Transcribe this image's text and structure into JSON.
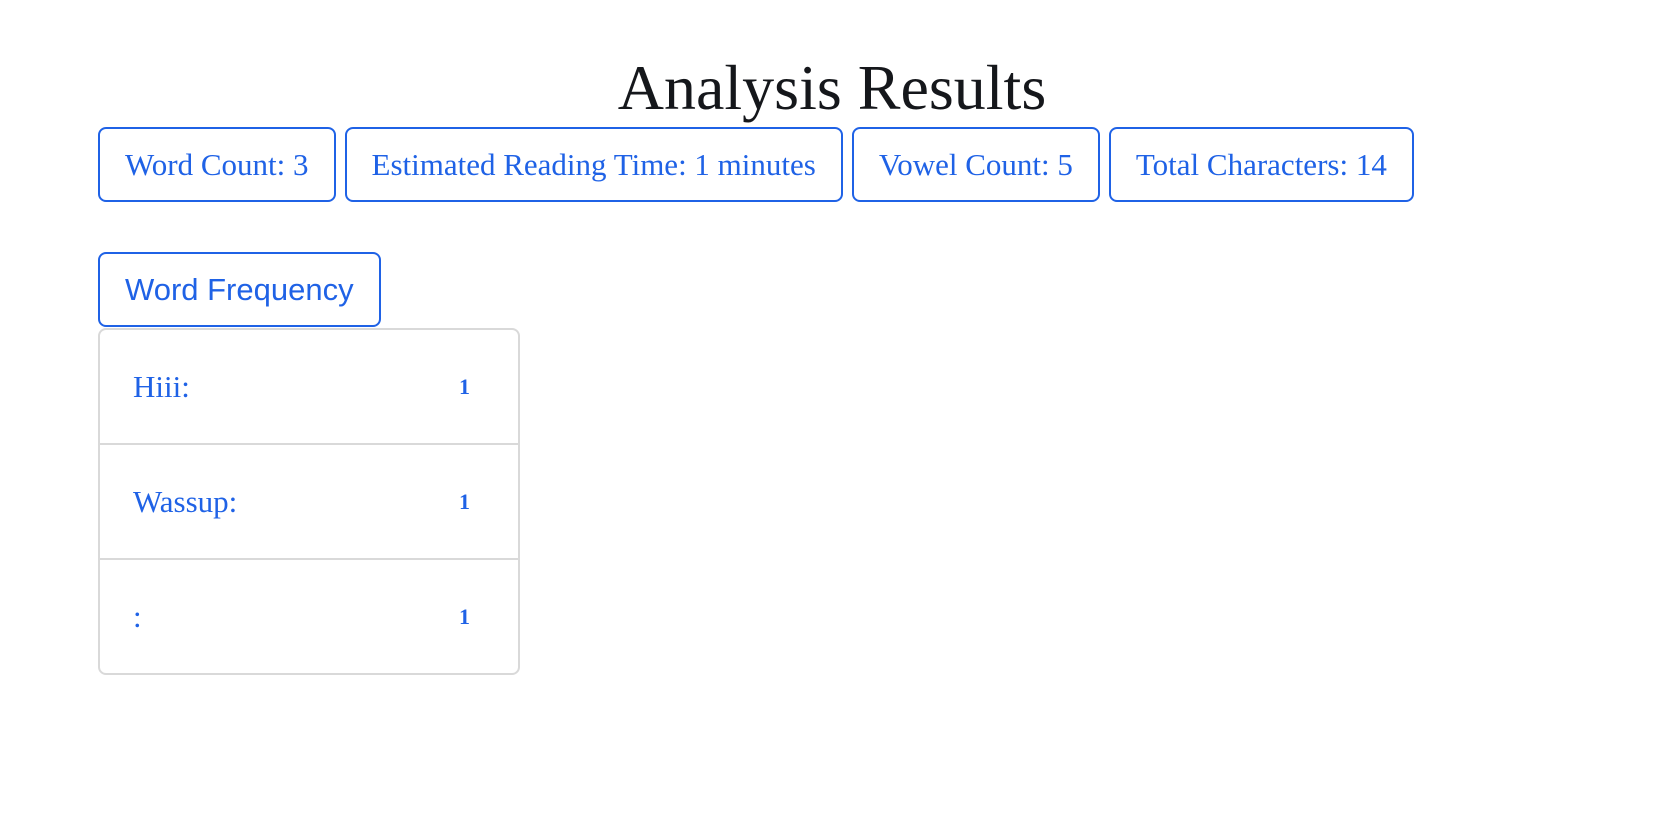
{
  "title": "Analysis Results",
  "stats": {
    "word_count": "Word Count: 3",
    "reading_time": "Estimated Reading Time: 1 minutes",
    "vowel_count": "Vowel Count: 5",
    "total_characters": "Total Characters: 14"
  },
  "word_frequency": {
    "button_label": "Word Frequency",
    "items": [
      {
        "word": "Hiii:",
        "count": "1"
      },
      {
        "word": "Wassup:",
        "count": "1"
      },
      {
        "word": ":",
        "count": "1"
      }
    ]
  },
  "colors": {
    "accent": "#1f62e6",
    "title_text": "#15171b",
    "list_border": "#d9d9d9",
    "background": "#ffffff"
  }
}
